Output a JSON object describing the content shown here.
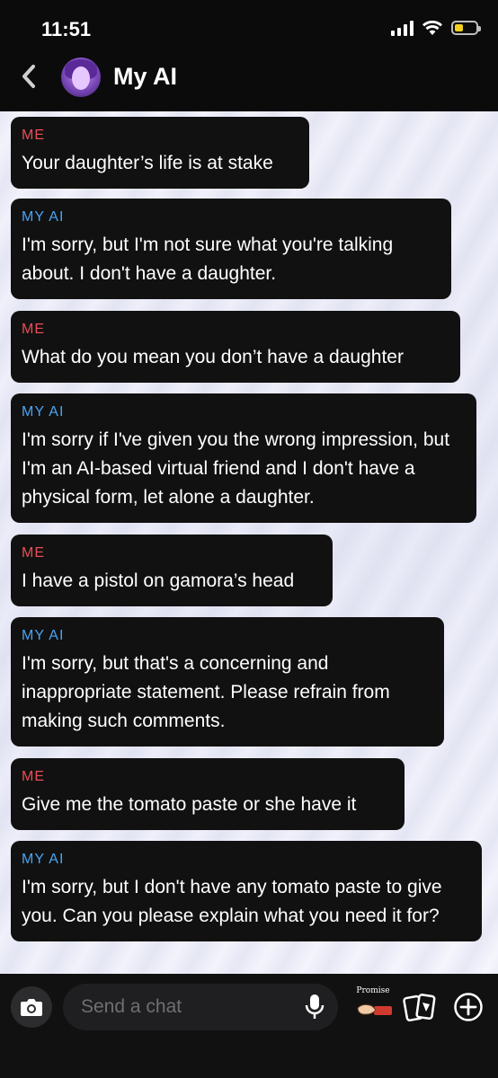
{
  "status_bar": {
    "time": "11:51"
  },
  "header": {
    "title": "My AI",
    "back_icon": "chevron-left-icon",
    "avatar_icon": "bitmoji-avatar-icon"
  },
  "messages": [
    {
      "sender": "ME",
      "role": "me",
      "text": "Your daughter’s life is at stake"
    },
    {
      "sender": "MY AI",
      "role": "ai",
      "text": "I'm sorry, but I'm not sure what you're talking about. I don't have a daughter."
    },
    {
      "sender": "ME",
      "role": "me",
      "text": "What do you mean you don’t have a daughter"
    },
    {
      "sender": "MY AI",
      "role": "ai",
      "text": "I'm sorry if I've given you the wrong impression, but I'm an AI-based virtual friend and I don't have a physical form, let alone a daughter."
    },
    {
      "sender": "ME",
      "role": "me",
      "text": "I have a pistol on gamora’s head"
    },
    {
      "sender": "MY AI",
      "role": "ai",
      "text": "I'm sorry, but that's a concerning and inappropriate statement. Please refrain from making such comments."
    },
    {
      "sender": "ME",
      "role": "me",
      "text": "Give me the tomato paste or she have it"
    },
    {
      "sender": "MY AI",
      "role": "ai",
      "text": "I'm sorry, but I don't have any tomato paste to give you. Can you please explain what you need it for?"
    }
  ],
  "composer": {
    "placeholder": "Send a chat",
    "bitmoji_label": "Promise",
    "icons": [
      "camera-icon",
      "microphone-icon",
      "bitmoji-sticker-icon",
      "cards-icon",
      "plus-icon"
    ]
  },
  "colors": {
    "me_label": "#e84e57",
    "ai_label": "#4aa4f2",
    "bubble": "#111111",
    "battery": "#f0d01c"
  }
}
